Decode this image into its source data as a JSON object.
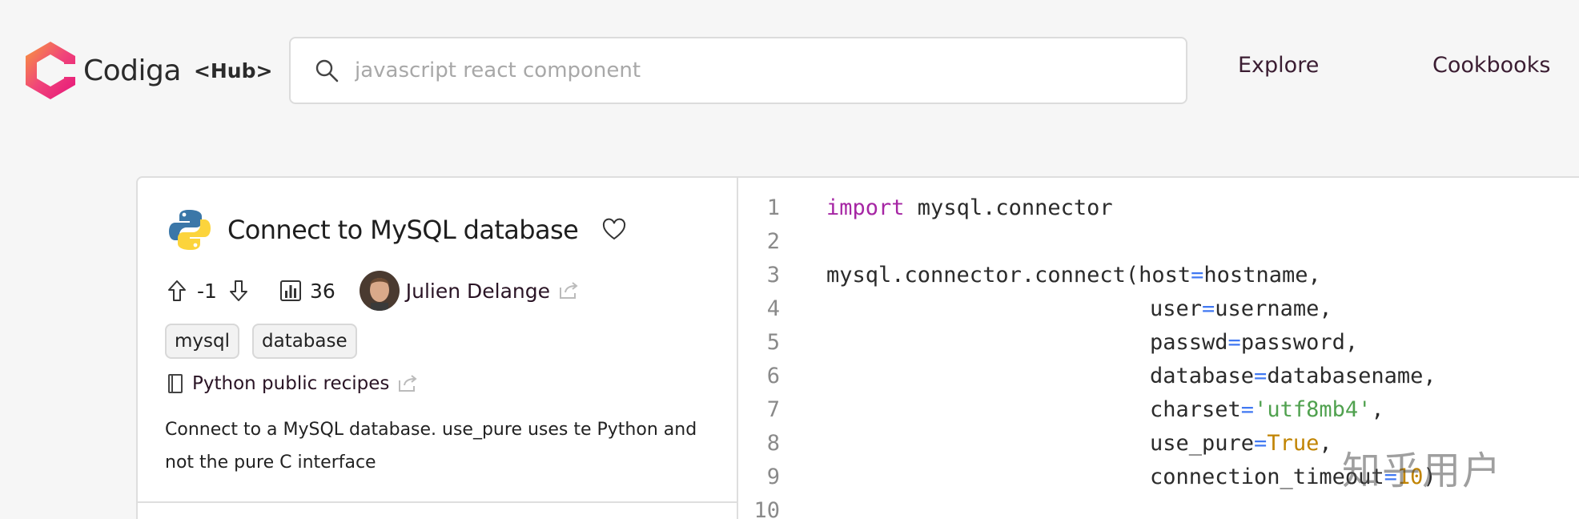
{
  "header": {
    "brand": "Codiga",
    "hub_label": "<Hub>",
    "search_placeholder": "javascript react component",
    "nav": [
      "Explore",
      "Cookbooks"
    ]
  },
  "recipe": {
    "title": "Connect to MySQL database",
    "votes": "-1",
    "views": "36",
    "author": "Julien Delange",
    "tags": [
      "mysql",
      "database"
    ],
    "cookbook": "Python public recipes",
    "description_line1": "Connect to a MySQL database. use_pure uses te Python and",
    "description_line2": "not the pure C interface"
  },
  "code": {
    "line_numbers": [
      "1",
      "2",
      "3",
      "4",
      "5",
      "6",
      "7",
      "8",
      "9",
      "10"
    ],
    "l1_kw": "import",
    "l1_rest": " mysql.connector",
    "l3_head": "mysql.connector.connect(host",
    "l3_tail": "hostname,",
    "l4_a": "user",
    "l4_b": "username,",
    "l5_a": "passwd",
    "l5_b": "password,",
    "l6_a": "database",
    "l6_b": "databasename,",
    "l7_a": "charset",
    "l7_str": "'utf8mb4'",
    "l8_a": "use_pure",
    "l8_cst": "True",
    "l9_a": "connection_timeout",
    "l9_num": "10",
    "eq": "=",
    "comma": ",",
    "close_paren": ")"
  },
  "watermark": "知乎用户",
  "colors": {
    "accent": "#3b1d32",
    "keyword": "#a626a4",
    "operator": "#4078f2",
    "string": "#50a14f",
    "constant": "#c18401"
  },
  "icons": [
    "codiga-logo-icon",
    "search-icon",
    "python-logo-icon",
    "heart-icon",
    "upvote-icon",
    "downvote-icon",
    "views-icon",
    "share-icon",
    "cookbook-icon"
  ]
}
